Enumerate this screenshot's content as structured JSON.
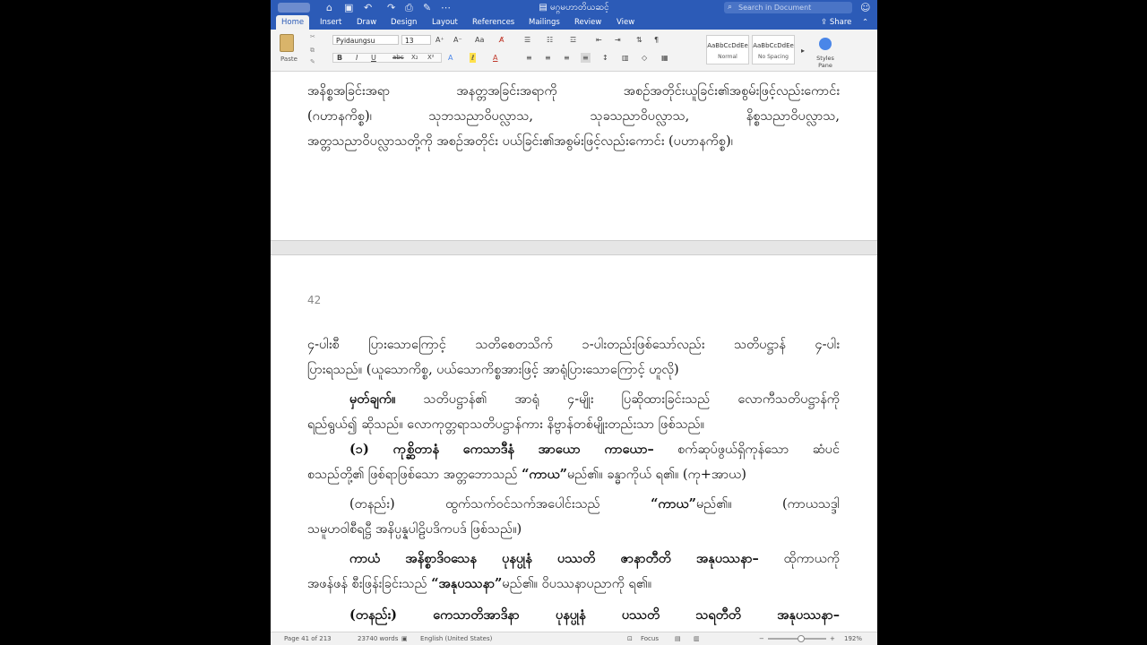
{
  "window": {
    "title": "မဂ္ဂမဟာတိယဆင့်",
    "search_placeholder": "Search in Document",
    "share_label": "Share"
  },
  "menu": {
    "tabs": [
      "Home",
      "Insert",
      "Draw",
      "Design",
      "Layout",
      "References",
      "Mailings",
      "Review",
      "View"
    ],
    "active_tab": "Home"
  },
  "ribbon": {
    "paste_label": "Paste",
    "font_name": "Pyidaungsu",
    "font_size": "13",
    "styles": [
      {
        "sample": "AaBbCcDdEe",
        "name": "Normal"
      },
      {
        "sample": "AaBbCcDdEe",
        "name": "No Spacing"
      }
    ],
    "styles_pane_label": "Styles Pane"
  },
  "document": {
    "top_page_lines": [
      "အနိစ္စအခြင်းအရာ   အနတ္တအခြင်းအရာကို   အစဉ်အတိုင်းယူခြင်း၏အစွမ်းဖြင့်လည်းကောင်း",
      "(ဂဟာနကိစ္စ)၊   သုဘသညာဝိပလ္လာသ,   သုခသညာဝိပလ္လာသ,   နိစ္စသညာဝိပလ္လာသ,",
      "အတ္တသညာဝိပလ္လာသတို့ကို  အစဉ်အတိုင်း  ပယ်ခြင်း၏အစွမ်းဖြင့်လည်းကောင်း  (ပဟာနကိစ္စ)၊"
    ],
    "page_number": "42",
    "p1": [
      "၄-ပါးစီ ပြားသောကြောင့် သတိစေတသိက် ၁-ပါးတည်းဖြစ်သော်လည်း သတိပဋ္ဌာန် ၄-ပါး",
      "ပြားရသည်။ (ယူသောကိစ္စ, ပယ်သောကိစ္စအားဖြင့် အာရုံပြားသောကြောင့် ဟူလို)"
    ],
    "p2_bold": "မှတ်ချက်။",
    "p2": [
      " သတိပဋ္ဌာန်၏ အာရုံ ၄-မျိုး ပြဆိုထားခြင်းသည် လောကီသတိပဋ္ဌာန်ကို",
      "ရည်ရွယ်၍ ဆိုသည်။ လောကုတ္တရာသတိပဋ္ဌာန်ကား နိဗ္ဗာန်တစ်မျိုးတည်းသာ ဖြစ်သည်။"
    ],
    "p3_bold": "(၁) ကုစ္ဆိတာနံ ကေသာဒီနံ အာယော ကာယော–",
    "p3": [
      " စက်ဆုပ်ဖွယ်ရှိကုန်သော ဆံပင်",
      "စသည်တို့၏ ဖြစ်ရာဖြစ်သော အတ္တဘောသည် ",
      "“ကာယ”",
      "မည်၏။ ခန္ဓာကိုယ် ရ၏။ (ကု+အာယ)"
    ],
    "p4": [
      "(တနည်း)   ထွက်သက်ဝင်သက်အပေါင်းသည်   ",
      "“ကာယ”",
      "မည်၏။   (ကာယသဒ္ဒါ",
      "သမူဟဝါစီရဋ္ဌီ အနိပ္ပန္နပါဠိပဒိကပဒ် ဖြစ်သည်။)"
    ],
    "p5_bold": "ကာယံ အနိစ္စာဒိဝသေန ပုနပ္ပုနံ ပဿတိ ဇာနာတီတိ အနုပဿနာ–",
    "p5": [
      " ထိုကာယကို",
      "အဖန်ဖန် စီးဖြန်းခြင်းသည် ",
      "“အနုပဿနာ”",
      "မည်၏။ ဝိပဿနာပညာကို ရ၏။"
    ],
    "p6_bold": "(တနည်း)   ကေသာတိအာဒိနာ   ပုနပ္ပုနံ   ပဿတိ   သရတီတိ   အနုပဿနာ–"
  },
  "status": {
    "page": "Page 41 of 213",
    "words": "23740 words",
    "language": "English (United States)",
    "focus": "Focus",
    "zoom": "192%"
  }
}
